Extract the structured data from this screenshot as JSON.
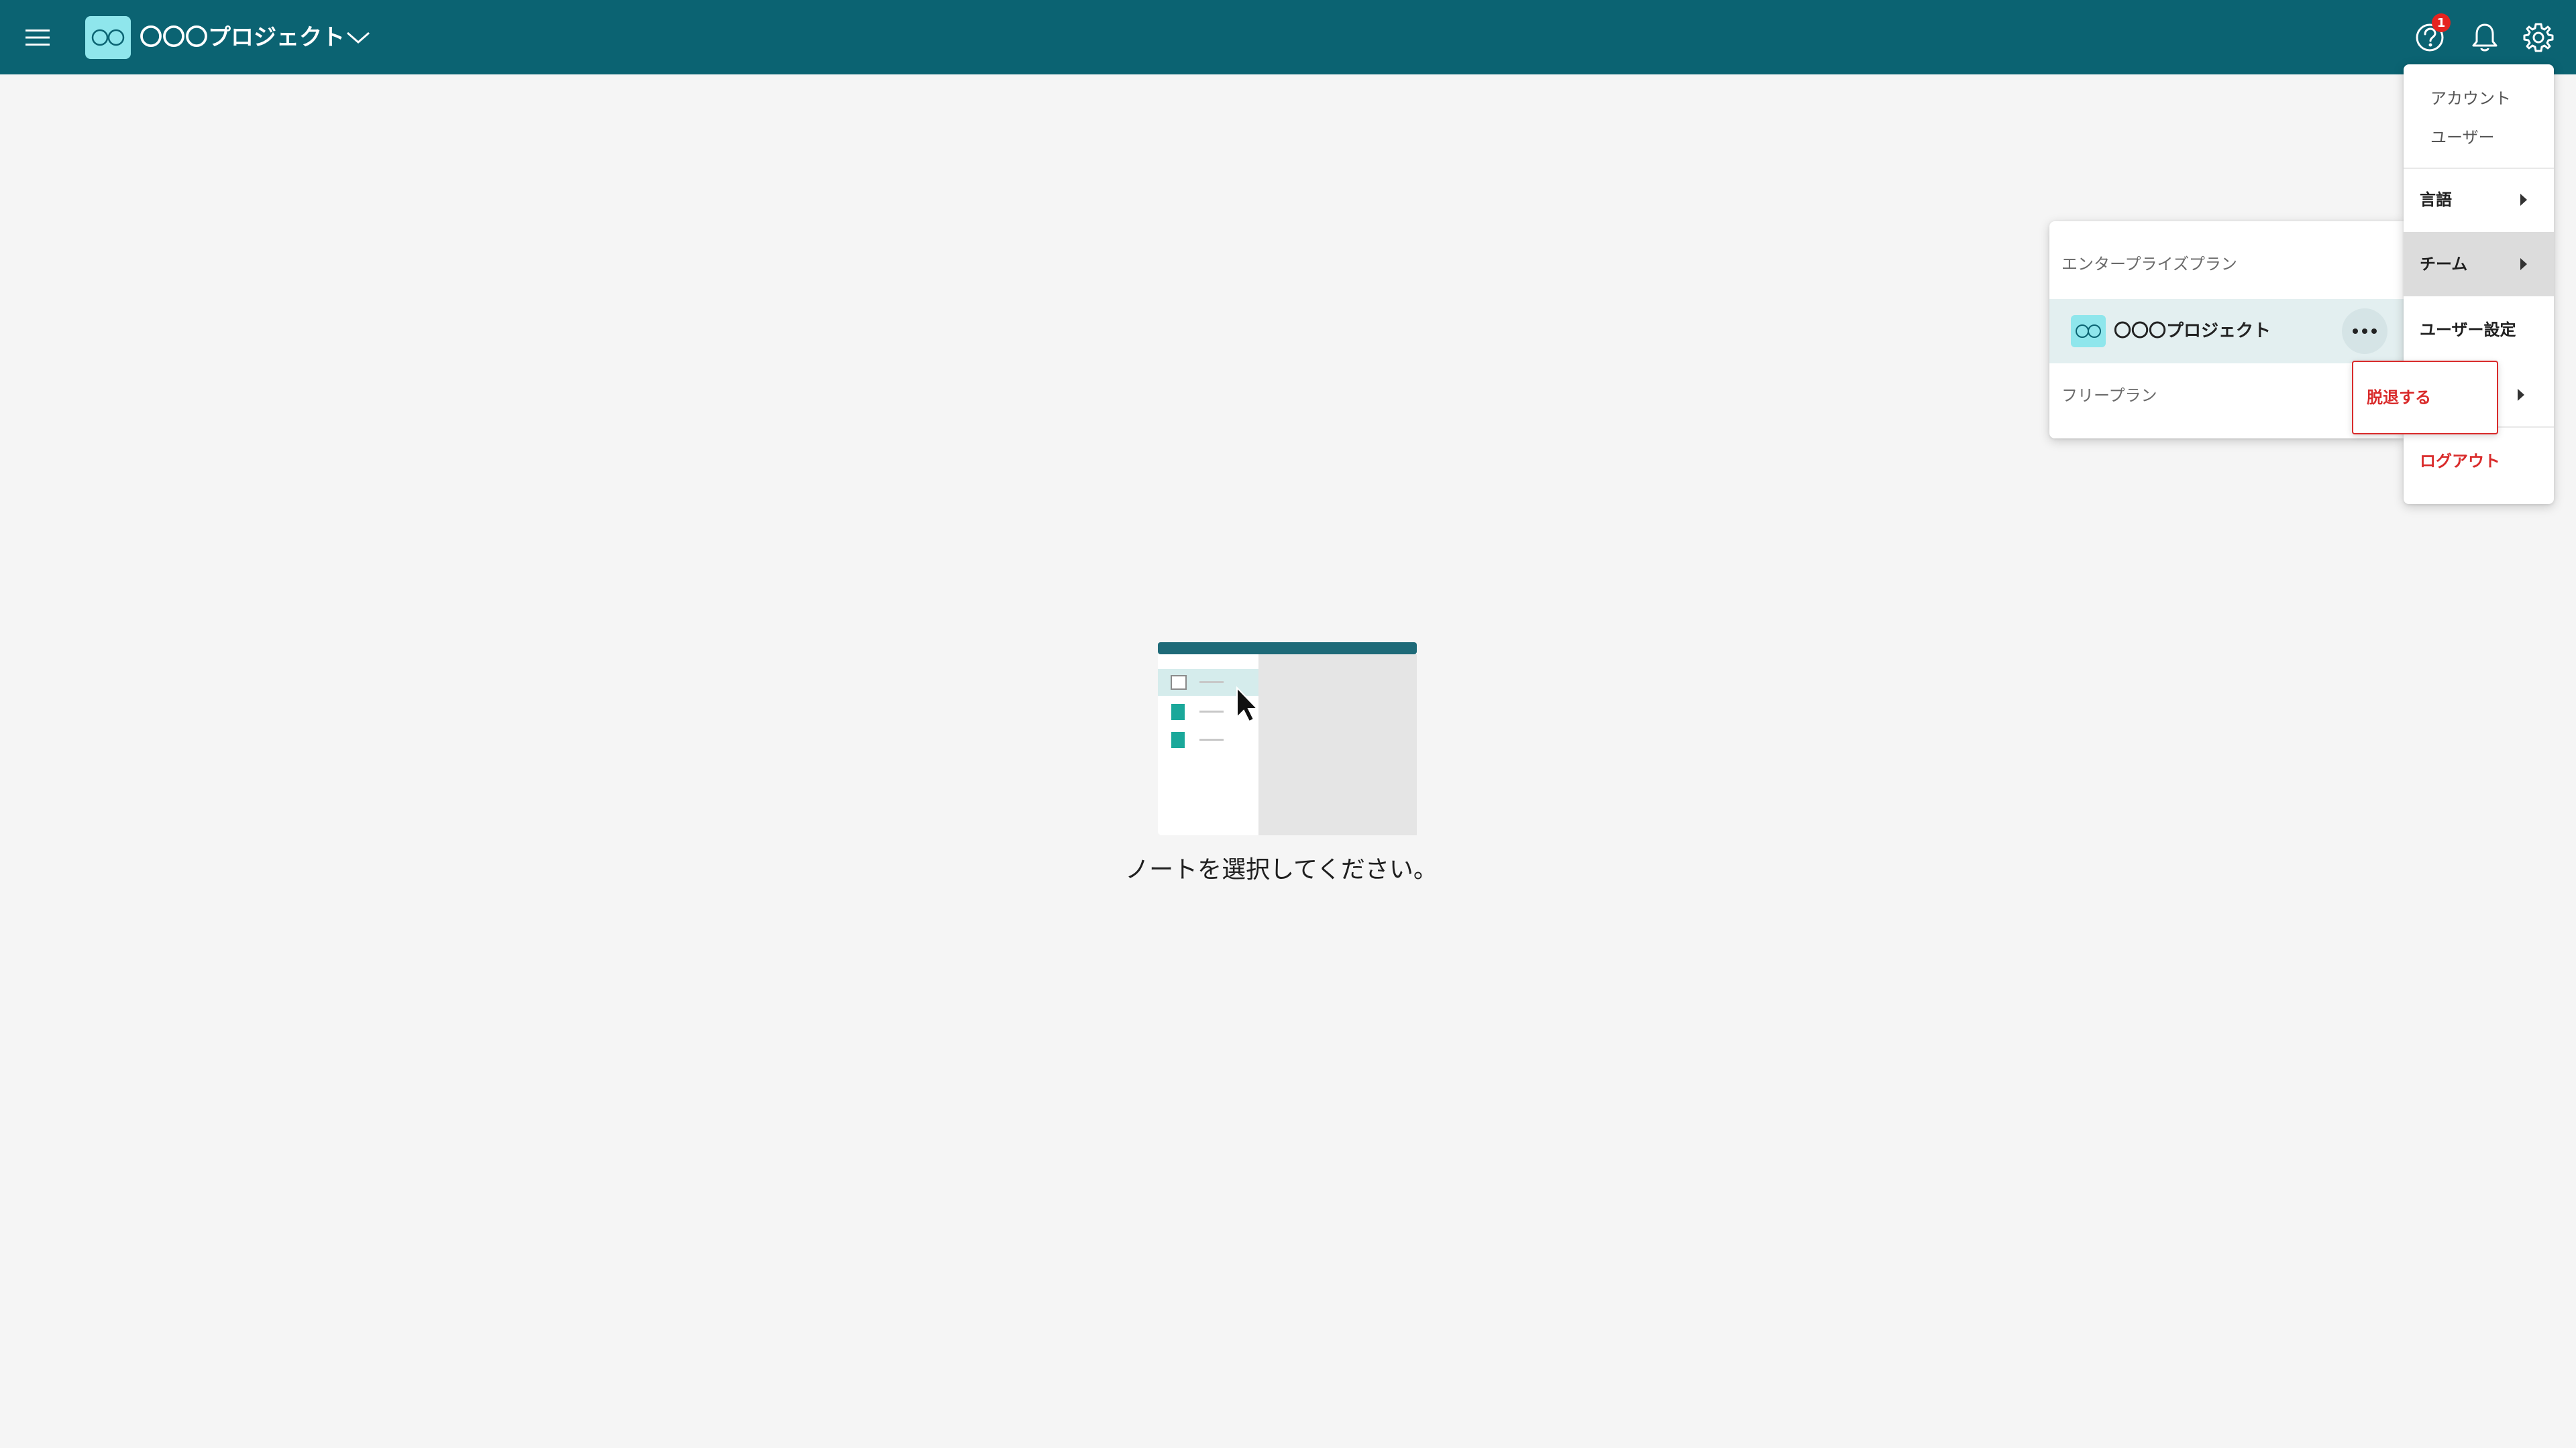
{
  "header": {
    "menu_icon": "hamburger-menu-icon",
    "logo_icon": "infinity-logo-icon",
    "project_title": "〇〇〇プロジェクト",
    "caret_icon": "chevron-down-icon",
    "help_icon": "help-circle-icon",
    "help_badge_count": "1",
    "notification_icon": "bell-icon",
    "settings_icon": "gear-icon",
    "colors": {
      "bar": "#0b6372",
      "logo_bg": "#8fe6ec",
      "badge": "#e5231f"
    }
  },
  "main": {
    "empty_message": "ノートを選択してください。"
  },
  "settings_menu": {
    "account_heading": "アカウント",
    "user_heading": "ユーザー",
    "language": "言語",
    "team": "チーム",
    "user_settings": "ユーザー設定",
    "logout": "ログアウト",
    "colors": {
      "danger": "#d92b2b"
    }
  },
  "team_menu": {
    "enterprise_section": "エンタープライズプラン",
    "project_name": "〇〇〇プロジェクト",
    "more_icon": "more-horizontal-icon",
    "free_section": "フリープラン"
  },
  "leave_popup": {
    "label": "脱退する"
  }
}
